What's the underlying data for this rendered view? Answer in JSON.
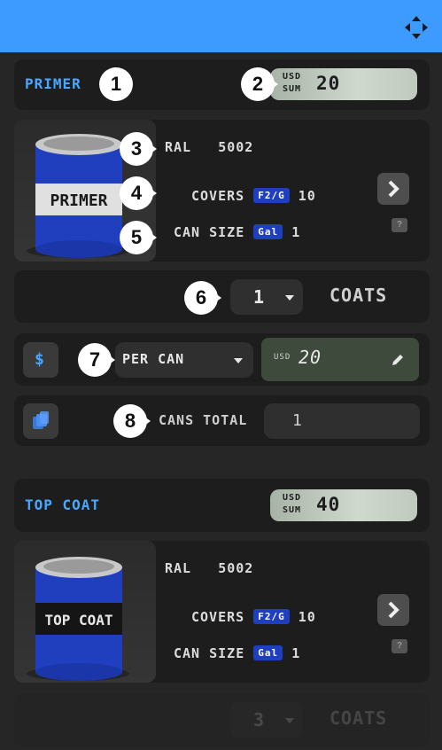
{
  "header": {
    "move_icon": "move-arrows-icon",
    "color": "#3d9bff"
  },
  "markers": [
    "1",
    "2",
    "3",
    "4",
    "5",
    "6",
    "7",
    "8"
  ],
  "primer": {
    "title": "PRIMER",
    "sum_currency": "USD",
    "sum_label": "SUM",
    "sum_value": "20",
    "can_label": "PRIMER",
    "ral_label": "RAL",
    "ral_value": "5002",
    "covers_label": "COVERS",
    "covers_unit": "F2/G",
    "covers_value": "10",
    "can_size_label": "CAN SIZE",
    "can_size_unit": "Gal",
    "can_size_value": "1",
    "help": "?",
    "coats_value": "1",
    "coats_label": "COATS",
    "price_icon": "$",
    "price_mode": "PER CAN",
    "price_currency": "USD",
    "price_value": "20",
    "cans_total_label": "CANS TOTAL",
    "cans_total_value": "1"
  },
  "topcoat": {
    "title": "TOP COAT",
    "sum_currency": "USD",
    "sum_label": "SUM",
    "sum_value": "40",
    "can_label": "TOP COAT",
    "ral_label": "RAL",
    "ral_value": "5002",
    "covers_label": "COVERS",
    "covers_unit": "F2/G",
    "covers_value": "10",
    "can_size_label": "CAN SIZE",
    "can_size_unit": "Gal",
    "can_size_value": "1",
    "help": "?",
    "coats_value": "3",
    "coats_label": "COATS"
  }
}
